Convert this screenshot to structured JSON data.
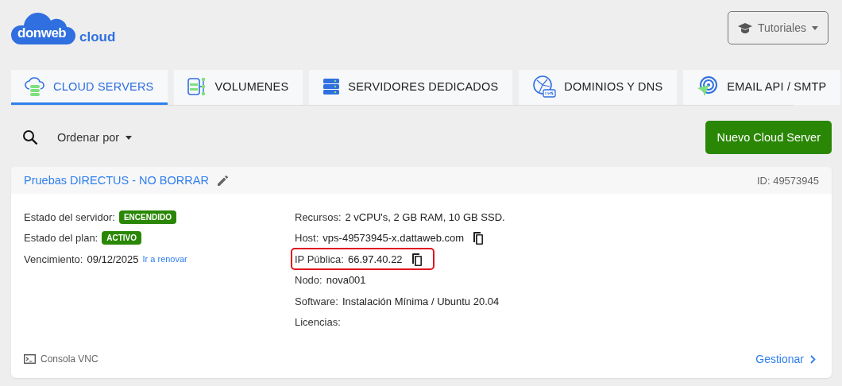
{
  "logo": {
    "name": "donweb",
    "suffix": "cloud"
  },
  "tutorials_button": {
    "label": "Tutoriales"
  },
  "tabs": [
    {
      "label": "CLOUD SERVERS",
      "kind": "cloud",
      "selected": true
    },
    {
      "label": "VOLUMENES",
      "kind": "volumes",
      "selected": false
    },
    {
      "label": "SERVIDORES DEDICADOS",
      "kind": "dedicated",
      "selected": false
    },
    {
      "label": "DOMINIOS Y DNS",
      "kind": "dns",
      "selected": false
    },
    {
      "label": "EMAIL API / SMTP",
      "kind": "email",
      "selected": false
    }
  ],
  "toolbar": {
    "sort_label": "Ordenar por",
    "new_button": "Nuevo Cloud Server"
  },
  "server": {
    "name": "Pruebas DIRECTUS - NO BORRAR",
    "id": "ID: 49573945",
    "status_rows": [
      {
        "label": "Estado del servidor:",
        "badge": "ENCENDIDO"
      },
      {
        "label": "Estado del plan:",
        "badge": "ACTIVO"
      },
      {
        "label": "Vencimiento:",
        "value": "09/12/2025",
        "link": "Ir a renovar"
      }
    ],
    "detail_rows": [
      {
        "label": "Recursos:",
        "value": "2 vCPU's, 2 GB RAM, 10 GB SSD.",
        "copy": false,
        "highlighted": false
      },
      {
        "label": "Host:",
        "value": "vps-49573945-x.dattaweb.com",
        "copy": true,
        "highlighted": false
      },
      {
        "label": "IP Pública:",
        "value": "66.97.40.22",
        "copy": true,
        "highlighted": true
      },
      {
        "label": "Nodo:",
        "value": "nova001",
        "copy": false,
        "highlighted": false
      },
      {
        "label": "Software:",
        "value": "Instalación Mínima / Ubuntu 20.04",
        "copy": false,
        "highlighted": false
      },
      {
        "label": "Licencias:",
        "copy": false,
        "highlighted": false
      }
    ],
    "console_link": "Consola VNC",
    "manage_link": "Gestionar"
  }
}
